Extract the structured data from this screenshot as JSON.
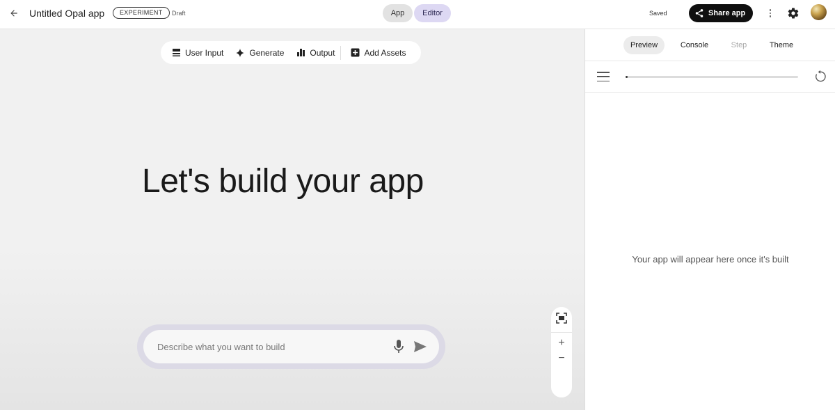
{
  "topbar": {
    "back_icon": "arrow-left-icon",
    "title": "Untitled Opal app",
    "badge": "EXPERIMENT",
    "status": "Draft",
    "mode_tabs": [
      {
        "label": "App",
        "active": false
      },
      {
        "label": "Editor",
        "active": true
      }
    ],
    "saved_label": "Saved",
    "share_label": "Share app",
    "share_icon": "share-icon",
    "more_icon": "more-vert-icon",
    "settings_icon": "gear-icon"
  },
  "canvas": {
    "toolbar": [
      {
        "label": "User Input",
        "icon": "user-input-icon"
      },
      {
        "label": "Generate",
        "icon": "sparkle-icon"
      },
      {
        "label": "Output",
        "icon": "output-icon"
      },
      {
        "label": "Add Assets",
        "icon": "add-box-icon"
      }
    ],
    "hero_text": "Let's build your app",
    "prompt": {
      "placeholder": "Describe what you want to build",
      "value": ""
    },
    "zoom": {
      "fit_icon": "fit-screen-icon",
      "zoom_in": "+",
      "zoom_out": "−"
    }
  },
  "preview_panel": {
    "tabs": [
      {
        "label": "Preview",
        "active": true,
        "disabled": false
      },
      {
        "label": "Console",
        "active": false,
        "disabled": false
      },
      {
        "label": "Step",
        "active": false,
        "disabled": true
      },
      {
        "label": "Theme",
        "active": false,
        "disabled": false
      }
    ],
    "progress": 0.01,
    "empty_message": "Your app will appear here once it's built"
  },
  "colors": {
    "accent_editor": "#ddd8f3",
    "share_button": "#0f0f0f",
    "prompt_ring": "#dcdae6",
    "canvas_bg": "#f1f1f1"
  }
}
